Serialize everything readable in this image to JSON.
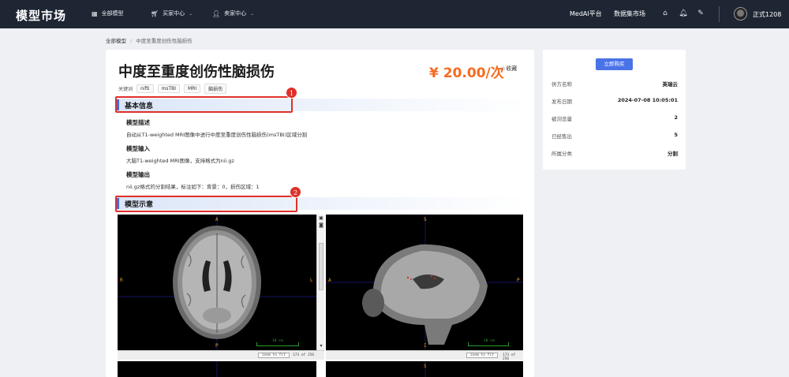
{
  "nav": {
    "logo": "模型市场",
    "items": [
      {
        "label": "全部模型"
      },
      {
        "label": "买家中心"
      },
      {
        "label": "卖家中心"
      }
    ],
    "right_links": [
      "MedAI平台",
      "数据集市场"
    ],
    "username": "正式1208"
  },
  "breadcrumb": {
    "root": "全部模型",
    "current": "中度至重度创伤性脑损伤"
  },
  "product": {
    "title": "中度至重度创伤性脑损伤",
    "price": "¥ 20.00/次",
    "favorite": "☆收藏",
    "keywords_label": "关键词",
    "keywords": [
      "nifti",
      "msTBI",
      "MRI",
      "脑损伤"
    ]
  },
  "sections": {
    "basic_info": "基本信息",
    "model_demo": "模型示意"
  },
  "details": [
    {
      "heading": "模型描述",
      "text": "自动从T1-weighted MRI图像中进行中度至重度创伤性脑损伤(msTBI)区域分割"
    },
    {
      "heading": "模型输入",
      "text": "大脑T1-weighted MRI图像，支持格式为nii.gz"
    },
    {
      "heading": "模型输出",
      "text": "nii.gz格式的分割结果，标注如下：背景：0，损伤区域：1"
    }
  ],
  "annotations": [
    "1",
    "2"
  ],
  "viewer": {
    "axial_labels": {
      "top": "A",
      "bottom": "P",
      "left": "R",
      "right": "L"
    },
    "sagittal_labels": {
      "top": "S",
      "bottom": "I",
      "left": "A",
      "right": "P"
    },
    "scale_label": "10 cm",
    "zoom_button": "zoom to fit",
    "slice_left": "173 of 256",
    "slice_right": "100 of 1",
    "lower_label": "S"
  },
  "sidebar": {
    "buy_button": "立即购买",
    "rows": [
      {
        "key": "供方名称",
        "value": "英瑞云"
      },
      {
        "key": "发布日期",
        "value": "2024-07-08 10:05:01"
      },
      {
        "key": "被浏览量",
        "value": "2"
      },
      {
        "key": "已经售出",
        "value": "5"
      },
      {
        "key": "所属分类",
        "value": "分割"
      }
    ]
  },
  "colors": {
    "accent": "#4a73e8",
    "price": "#f56b1f",
    "nav_bg": "#1e2634",
    "annotation": "#e0302a"
  }
}
